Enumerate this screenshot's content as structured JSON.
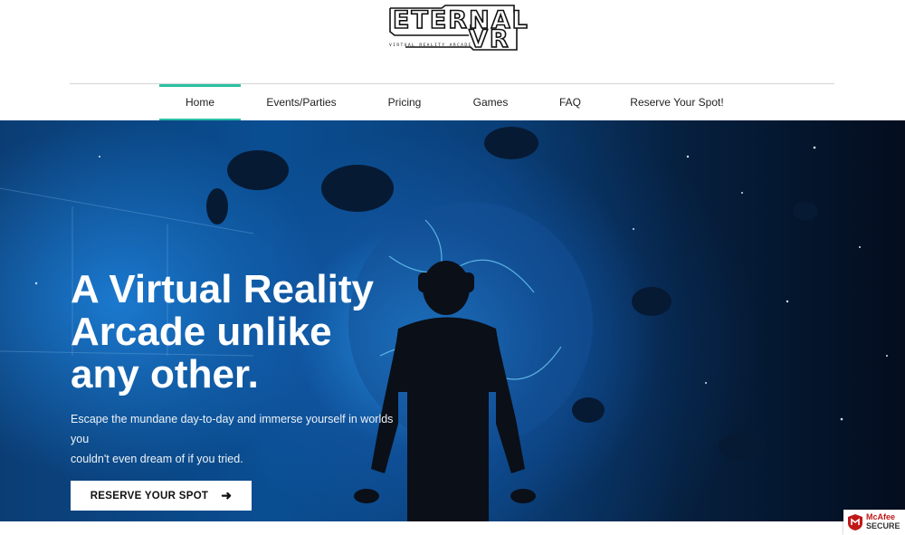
{
  "logo": {
    "word": "ETERNAL",
    "vr": "VR",
    "tagline": "VIRTUAL REALITY ARCADE"
  },
  "nav": {
    "items": [
      {
        "label": "Home",
        "active": true
      },
      {
        "label": "Events/Parties",
        "active": false
      },
      {
        "label": "Pricing",
        "active": false
      },
      {
        "label": "Games",
        "active": false
      },
      {
        "label": "FAQ",
        "active": false
      },
      {
        "label": "Reserve Your Spot!",
        "active": false
      }
    ]
  },
  "hero": {
    "headline_line1": "A Virtual Reality",
    "headline_line2": "Arcade unlike",
    "headline_line3": "any other.",
    "subcopy_line1": "Escape the mundane day-to-day and immerse yourself in worlds you",
    "subcopy_line2": "couldn't even dream of if you tried.",
    "cta_label": "RESERVE YOUR SPOT",
    "cta_icon": "arrow-right-icon"
  },
  "badge": {
    "brand": "McAfee",
    "secure": "SECURE"
  },
  "colors": {
    "accent": "#2bc0a4",
    "hero_blue": "#0a4e92",
    "mcafee_red": "#c01818"
  }
}
